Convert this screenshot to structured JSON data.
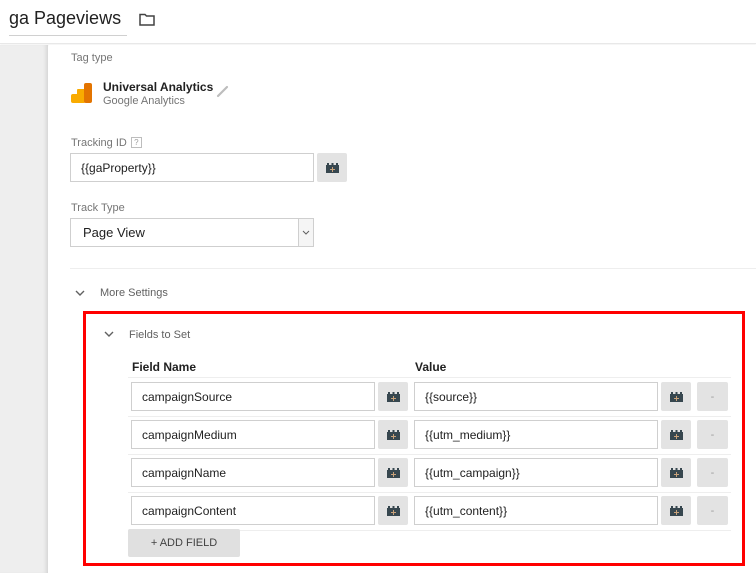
{
  "header": {
    "title": "ga Pageviews",
    "folder_icon": "folder-icon"
  },
  "tag_config": {
    "tag_type_label": "Tag type",
    "tag_type": {
      "name": "Universal Analytics",
      "vendor": "Google Analytics",
      "icon": "google-analytics-logo",
      "edit_icon": "pencil-icon"
    },
    "tracking_id": {
      "label": "Tracking ID",
      "help": "?",
      "value": "{{gaProperty}}"
    },
    "track_type": {
      "label": "Track Type",
      "selected": "Page View"
    }
  },
  "more_settings": {
    "label": "More Settings",
    "fields_to_set": {
      "label": "Fields to Set",
      "columns": [
        "Field Name",
        "Value"
      ],
      "rows": [
        {
          "field_name": "campaignSource",
          "value": "{{source}}",
          "remove": "-"
        },
        {
          "field_name": "campaignMedium",
          "value": "{{utm_medium}}",
          "remove": "-"
        },
        {
          "field_name": "campaignName",
          "value": "{{utm_campaign}}",
          "remove": "-"
        },
        {
          "field_name": "campaignContent",
          "value": "{{utm_content}}",
          "remove": "-"
        }
      ],
      "add_button": "+ ADD FIELD"
    }
  },
  "colors": {
    "highlight": "#ff0000",
    "ga_orange_dark": "#e37400",
    "ga_orange_light": "#f9ab00"
  }
}
